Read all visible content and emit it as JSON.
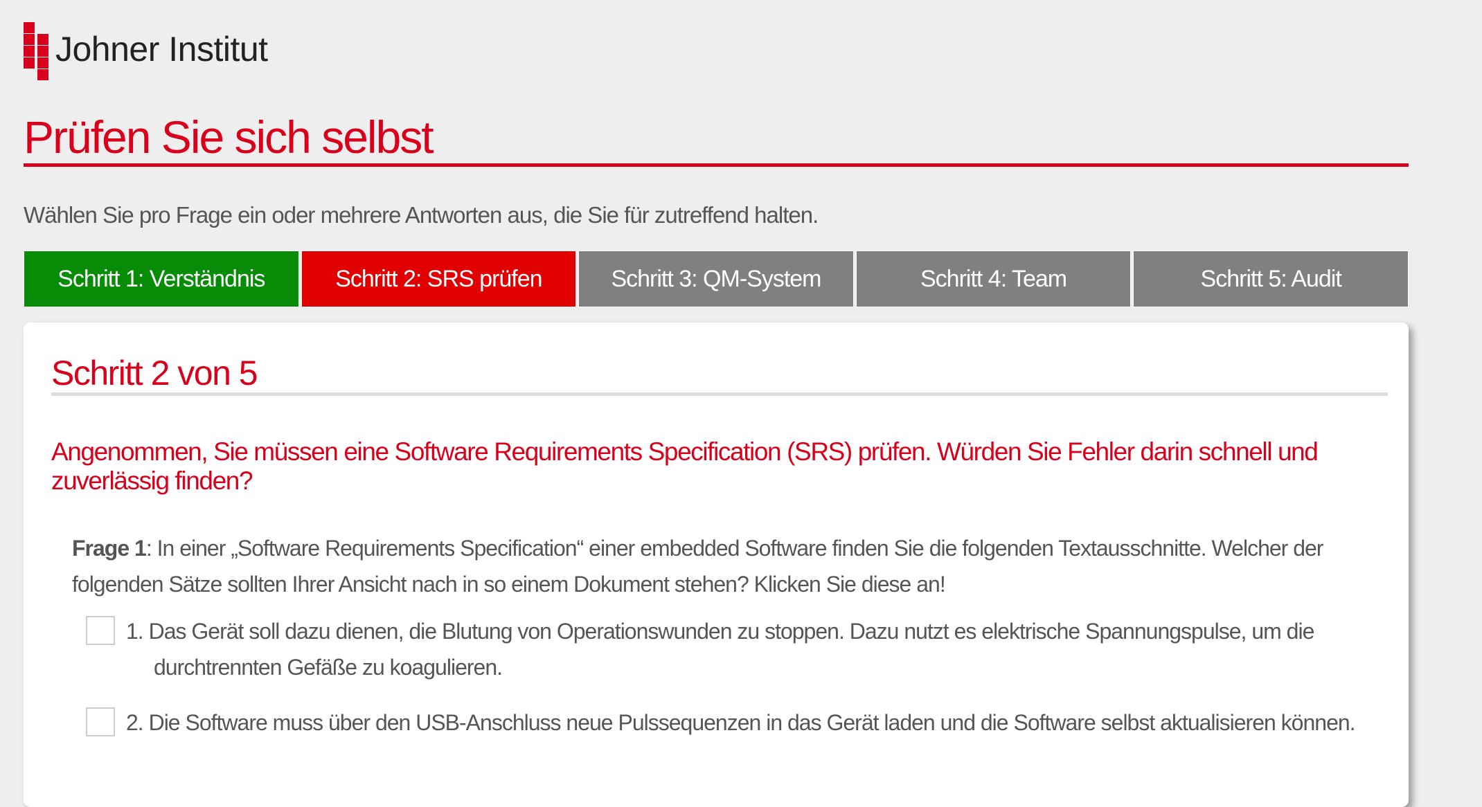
{
  "logo": {
    "text": "Johner Institut",
    "color": "#d9001b"
  },
  "page": {
    "title": "Prüfen Sie sich selbst",
    "intro": "Wählen Sie pro Frage ein oder mehrere Antworten aus, die Sie für zutreffend halten."
  },
  "steps": [
    {
      "label": "Schritt 1: Verständnis",
      "state": "done",
      "color": "#078c07"
    },
    {
      "label": "Schritt 2: SRS prüfen",
      "state": "active",
      "color": "#e00000"
    },
    {
      "label": "Schritt 3: QM-System",
      "state": "todo",
      "color": "#808080"
    },
    {
      "label": "Schritt 4: Team",
      "state": "todo",
      "color": "#808080"
    },
    {
      "label": "Schritt 5: Audit",
      "state": "todo",
      "color": "#808080"
    }
  ],
  "card": {
    "title": "Schritt 2 von 5",
    "question": "Angenommen, Sie müssen eine Software Requirements Specification (SRS) prüfen. Würden Sie Fehler darin schnell und zuverlässig finden?",
    "frage_label": "Frage 1",
    "frage_text": ": In einer „Software Requirements Specification“ einer embedded Software finden Sie die folgenden Textausschnitte. Welcher der folgenden Sätze sollten Ihrer Ansicht nach in so einem Dokument stehen? Klicken Sie diese an!",
    "options": [
      {
        "text": "1. Das Gerät soll dazu dienen, die Blutung von Operationswunden zu stoppen. Dazu nutzt es elektrische Spannungspulse, um die durchtrennten Gefäße zu koagulieren.",
        "checked": false
      },
      {
        "text": "2. Die Software muss über den USB-Anschluss neue Pulssequenzen in das Gerät laden und die Software selbst aktualisieren können.",
        "checked": false
      }
    ]
  }
}
